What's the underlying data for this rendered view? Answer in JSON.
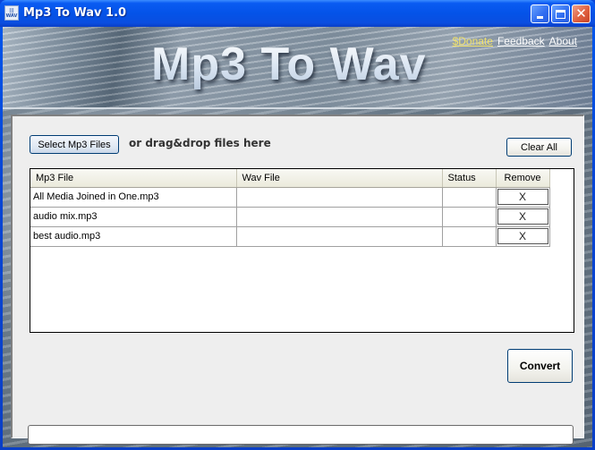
{
  "window": {
    "title": "Mp3 To Wav 1.0",
    "icon_text": [
      "|||",
      "WAV"
    ],
    "controls": {
      "minimize": "minimize",
      "maximize": "maximize",
      "close": "✕"
    }
  },
  "banner": {
    "title": "Mp3 To Wav",
    "links": {
      "donate": "$Donate",
      "feedback": "Feedback",
      "about": "About"
    }
  },
  "toolbar": {
    "select_label": "Select Mp3 Files",
    "drag_hint": "or drag&drop files here",
    "clear_label": "Clear All"
  },
  "table": {
    "columns": [
      "Mp3 File",
      "Wav File",
      "Status",
      "Remove"
    ],
    "rows": [
      {
        "mp3": "All Media Joined in One.mp3",
        "wav": "",
        "status": "",
        "remove": "X"
      },
      {
        "mp3": "audio mix.mp3",
        "wav": "",
        "status": "",
        "remove": "X"
      },
      {
        "mp3": "best audio.mp3",
        "wav": "",
        "status": "",
        "remove": "X"
      }
    ]
  },
  "actions": {
    "convert_label": "Convert"
  },
  "progress": {
    "value_percent": 0
  },
  "colors": {
    "donate_link": "#f2e26a",
    "titlebar": "#0453e8"
  }
}
